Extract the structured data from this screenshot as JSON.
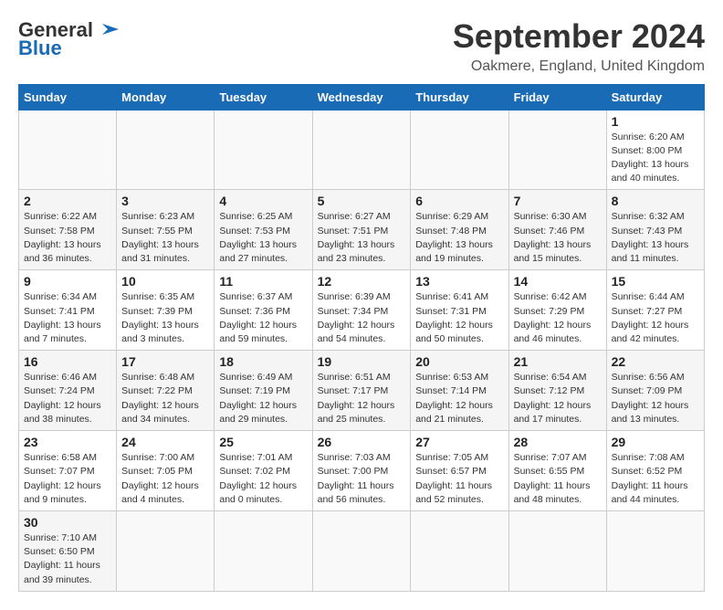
{
  "header": {
    "logo_line1": "General",
    "logo_line2": "Blue",
    "title": "September 2024",
    "subtitle": "Oakmere, England, United Kingdom"
  },
  "calendar": {
    "columns": [
      "Sunday",
      "Monday",
      "Tuesday",
      "Wednesday",
      "Thursday",
      "Friday",
      "Saturday"
    ],
    "weeks": [
      [
        {
          "day": "",
          "info": ""
        },
        {
          "day": "",
          "info": ""
        },
        {
          "day": "",
          "info": ""
        },
        {
          "day": "",
          "info": ""
        },
        {
          "day": "",
          "info": ""
        },
        {
          "day": "",
          "info": ""
        },
        {
          "day": "1",
          "info": "Sunrise: 6:20 AM\nSunset: 8:00 PM\nDaylight: 13 hours\nand 40 minutes."
        }
      ],
      [
        {
          "day": "2",
          "info": "Sunrise: 6:22 AM\nSunset: 7:58 PM\nDaylight: 13 hours\nand 36 minutes."
        },
        {
          "day": "3",
          "info": "Sunrise: 6:23 AM\nSunset: 7:55 PM\nDaylight: 13 hours\nand 31 minutes."
        },
        {
          "day": "4",
          "info": "Sunrise: 6:25 AM\nSunset: 7:53 PM\nDaylight: 13 hours\nand 27 minutes."
        },
        {
          "day": "5",
          "info": "Sunrise: 6:27 AM\nSunset: 7:51 PM\nDaylight: 13 hours\nand 23 minutes."
        },
        {
          "day": "6",
          "info": "Sunrise: 6:29 AM\nSunset: 7:48 PM\nDaylight: 13 hours\nand 19 minutes."
        },
        {
          "day": "7",
          "info": "Sunrise: 6:30 AM\nSunset: 7:46 PM\nDaylight: 13 hours\nand 15 minutes."
        },
        {
          "day": "8",
          "info": "Sunrise: 6:32 AM\nSunset: 7:43 PM\nDaylight: 13 hours\nand 11 minutes."
        }
      ],
      [
        {
          "day": "9",
          "info": "Sunrise: 6:34 AM\nSunset: 7:41 PM\nDaylight: 13 hours\nand 7 minutes."
        },
        {
          "day": "10",
          "info": "Sunrise: 6:35 AM\nSunset: 7:39 PM\nDaylight: 13 hours\nand 3 minutes."
        },
        {
          "day": "11",
          "info": "Sunrise: 6:37 AM\nSunset: 7:36 PM\nDaylight: 12 hours\nand 59 minutes."
        },
        {
          "day": "12",
          "info": "Sunrise: 6:39 AM\nSunset: 7:34 PM\nDaylight: 12 hours\nand 54 minutes."
        },
        {
          "day": "13",
          "info": "Sunrise: 6:41 AM\nSunset: 7:31 PM\nDaylight: 12 hours\nand 50 minutes."
        },
        {
          "day": "14",
          "info": "Sunrise: 6:42 AM\nSunset: 7:29 PM\nDaylight: 12 hours\nand 46 minutes."
        },
        {
          "day": "15",
          "info": "Sunrise: 6:44 AM\nSunset: 7:27 PM\nDaylight: 12 hours\nand 42 minutes."
        }
      ],
      [
        {
          "day": "16",
          "info": "Sunrise: 6:46 AM\nSunset: 7:24 PM\nDaylight: 12 hours\nand 38 minutes."
        },
        {
          "day": "17",
          "info": "Sunrise: 6:48 AM\nSunset: 7:22 PM\nDaylight: 12 hours\nand 34 minutes."
        },
        {
          "day": "18",
          "info": "Sunrise: 6:49 AM\nSunset: 7:19 PM\nDaylight: 12 hours\nand 29 minutes."
        },
        {
          "day": "19",
          "info": "Sunrise: 6:51 AM\nSunset: 7:17 PM\nDaylight: 12 hours\nand 25 minutes."
        },
        {
          "day": "20",
          "info": "Sunrise: 6:53 AM\nSunset: 7:14 PM\nDaylight: 12 hours\nand 21 minutes."
        },
        {
          "day": "21",
          "info": "Sunrise: 6:54 AM\nSunset: 7:12 PM\nDaylight: 12 hours\nand 17 minutes."
        },
        {
          "day": "22",
          "info": "Sunrise: 6:56 AM\nSunset: 7:09 PM\nDaylight: 12 hours\nand 13 minutes."
        }
      ],
      [
        {
          "day": "23",
          "info": "Sunrise: 6:58 AM\nSunset: 7:07 PM\nDaylight: 12 hours\nand 9 minutes."
        },
        {
          "day": "24",
          "info": "Sunrise: 7:00 AM\nSunset: 7:05 PM\nDaylight: 12 hours\nand 4 minutes."
        },
        {
          "day": "25",
          "info": "Sunrise: 7:01 AM\nSunset: 7:02 PM\nDaylight: 12 hours\nand 0 minutes."
        },
        {
          "day": "26",
          "info": "Sunrise: 7:03 AM\nSunset: 7:00 PM\nDaylight: 11 hours\nand 56 minutes."
        },
        {
          "day": "27",
          "info": "Sunrise: 7:05 AM\nSunset: 6:57 PM\nDaylight: 11 hours\nand 52 minutes."
        },
        {
          "day": "28",
          "info": "Sunrise: 7:07 AM\nSunset: 6:55 PM\nDaylight: 11 hours\nand 48 minutes."
        },
        {
          "day": "29",
          "info": "Sunrise: 7:08 AM\nSunset: 6:52 PM\nDaylight: 11 hours\nand 44 minutes."
        }
      ],
      [
        {
          "day": "30",
          "info": "Sunrise: 7:10 AM\nSunset: 6:50 PM\nDaylight: 11 hours\nand 39 minutes."
        },
        {
          "day": "",
          "info": ""
        },
        {
          "day": "",
          "info": ""
        },
        {
          "day": "",
          "info": ""
        },
        {
          "day": "",
          "info": ""
        },
        {
          "day": "",
          "info": ""
        },
        {
          "day": "",
          "info": ""
        }
      ]
    ]
  }
}
